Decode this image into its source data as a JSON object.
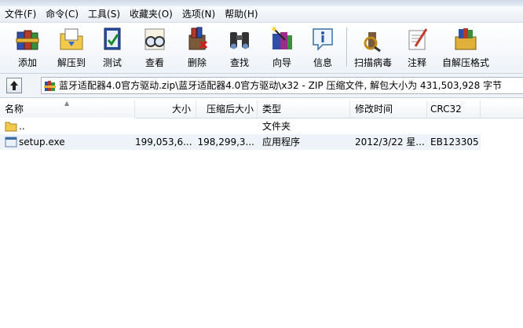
{
  "menu": [
    "文件(F)",
    "命令(C)",
    "工具(S)",
    "收藏夹(O)",
    "选项(N)",
    "帮助(H)"
  ],
  "toolbar": [
    {
      "label": "添加",
      "icon": "books-add-icon"
    },
    {
      "label": "解压到",
      "icon": "extract-folder-icon"
    },
    {
      "label": "测试",
      "icon": "test-book-icon"
    },
    {
      "label": "查看",
      "icon": "glasses-view-icon"
    },
    {
      "label": "删除",
      "icon": "delete-books-icon"
    },
    {
      "label": "查找",
      "icon": "binoculars-find-icon"
    },
    {
      "label": "向导",
      "icon": "wizard-wand-icon"
    },
    {
      "label": "信息",
      "icon": "info-icon"
    },
    {
      "label": "扫描病毒",
      "icon": "virus-scan-icon"
    },
    {
      "label": "注释",
      "icon": "comment-pen-icon"
    },
    {
      "label": "自解压格式",
      "icon": "sfx-box-icon"
    }
  ],
  "address": {
    "path": "蓝牙适配器4.0官方驱动.zip\\蓝牙适配器4.0官方驱动\\x32 - ZIP 压缩文件, 解包大小为 431,503,928 字节"
  },
  "columns": [
    "名称",
    "大小",
    "压缩后大小",
    "类型",
    "修改时间",
    "CRC32"
  ],
  "rows": [
    {
      "name": "..",
      "size": "",
      "packed": "",
      "type": "文件夹",
      "modified": "",
      "crc": "",
      "icon": "folder-icon"
    },
    {
      "name": "setup.exe",
      "size": "199,053,6...",
      "packed": "198,299,3...",
      "type": "应用程序",
      "modified": "2012/3/22 星...",
      "crc": "EB123305",
      "icon": "exe-file-icon"
    }
  ],
  "colors": {
    "accent": "#3a6ea5",
    "menubar": "#e9eef5",
    "toolbar": "#eef2f7"
  }
}
